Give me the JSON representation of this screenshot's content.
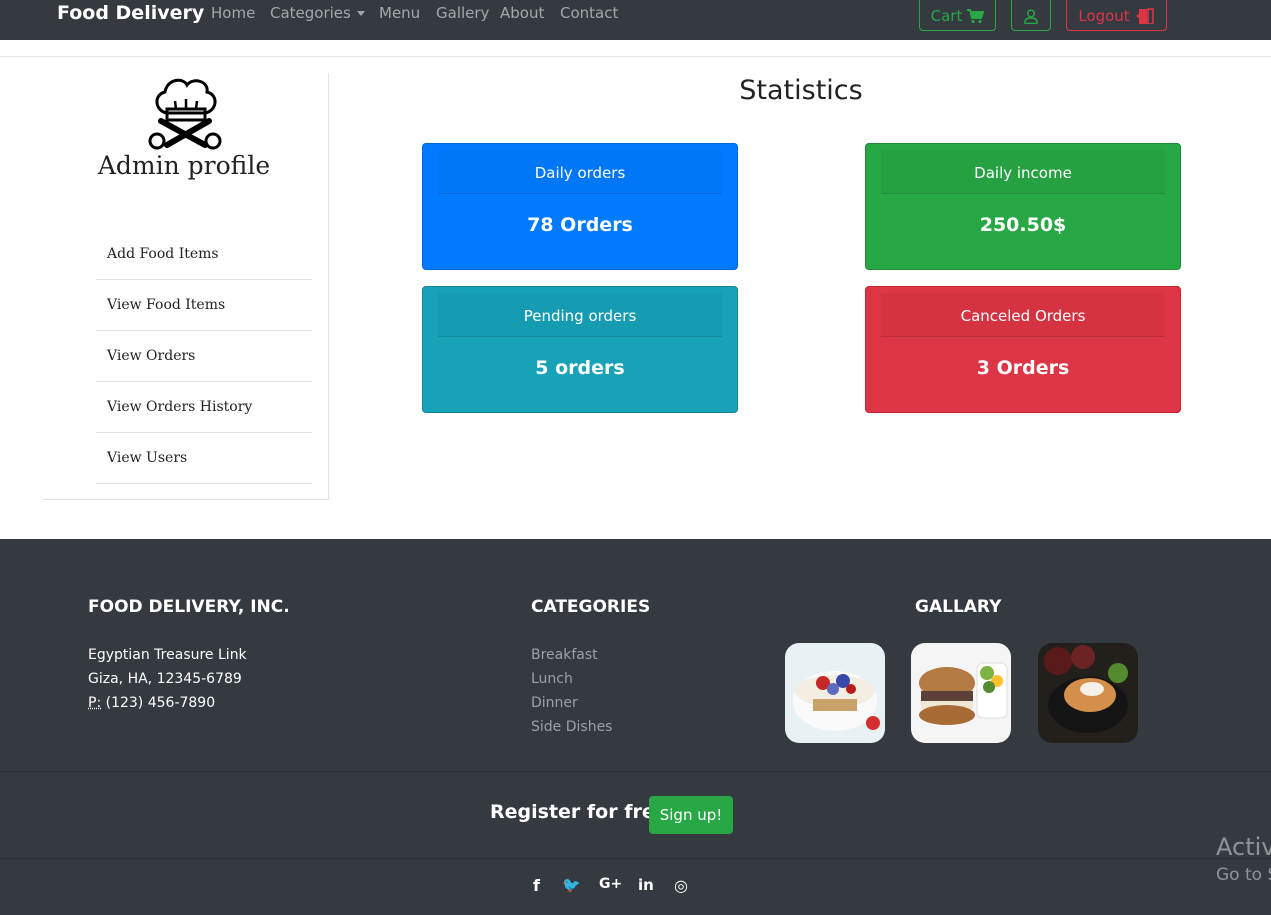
{
  "nav": {
    "brand": "Food Delivery",
    "links": [
      "Home",
      "Categories",
      "Menu",
      "Gallery",
      "About",
      "Contact"
    ],
    "cart_label": "Cart",
    "logout_label": "Logout"
  },
  "sidebar": {
    "title": "Admin profile",
    "items": [
      "Add Food Items",
      "View Food Items",
      "View Orders",
      "View Orders History",
      "View Users"
    ]
  },
  "stats": {
    "title": "Statistics",
    "cards": [
      {
        "label": "Daily orders",
        "value": "78 Orders",
        "color": "#007bff"
      },
      {
        "label": "Daily income",
        "value": "250.50$",
        "color": "#28a745"
      },
      {
        "label": "Pending orders",
        "value": "5 orders",
        "color": "#17a2b8"
      },
      {
        "label": "Canceled Orders",
        "value": "3 Orders",
        "color": "#dc3545"
      }
    ]
  },
  "footer": {
    "company_heading": "FOOD DELIVERY, INC.",
    "address_line1": "Egyptian Treasure Link",
    "address_line2": "Giza, HA, 12345-6789",
    "phone_prefix": "P:",
    "phone": "(123) 456-7890",
    "categories_heading": "CATEGORIES",
    "categories": [
      "Breakfast",
      "Lunch",
      "Dinner",
      "Side Dishes"
    ],
    "gallery_heading": "GALLARY",
    "register_text": "Register for free",
    "signup_label": "Sign up!",
    "social_icons": [
      "facebook-icon",
      "twitter-icon",
      "google-plus-icon",
      "linkedin-icon",
      "dribbble-icon"
    ],
    "social_glyphs": [
      "f",
      "🐦",
      "G+",
      "in",
      "◎"
    ]
  },
  "watermark": {
    "line1": "Activ",
    "line2": "Go to S"
  }
}
